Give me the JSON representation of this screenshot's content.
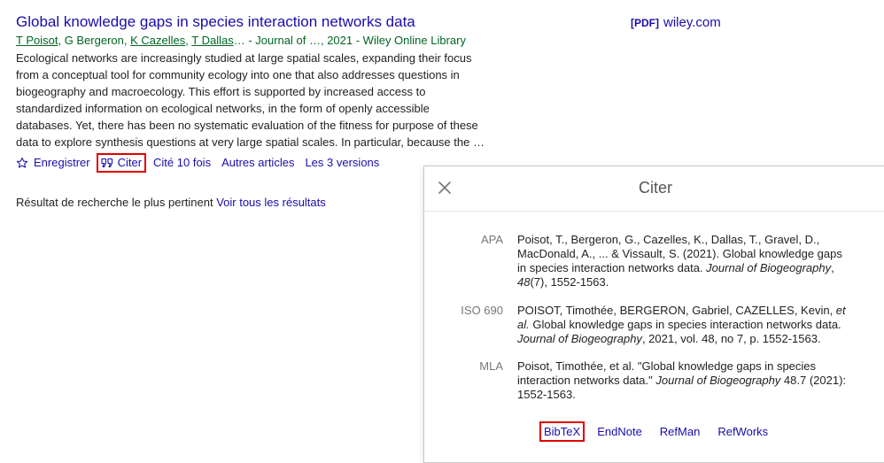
{
  "result": {
    "title": "Global knowledge gaps in species interaction networks data",
    "authors": [
      {
        "name": "T Poisot",
        "linked": true
      },
      {
        "name": "G Bergeron",
        "linked": false
      },
      {
        "name": "K Cazelles",
        "linked": true
      },
      {
        "name": "T Dallas",
        "linked": true
      }
    ],
    "authors_tail": "… - Journal of …, 2021 - Wiley Online Library",
    "snippet": [
      "Ecological networks are increasingly studied at large spatial scales, expanding their focus",
      "from a conceptual tool for community ecology into one that also addresses questions in",
      "biogeography and macroecology. This effort is supported by increased access to",
      "standardized information on ecological networks, in the form of openly accessible",
      "databases. Yet, there has been no systematic evaluation of the fitness for purpose of these",
      "data to explore synthesis questions at very large spatial scales. In particular, because the …"
    ],
    "actions": {
      "save": "Enregistrer",
      "cite": "Citer",
      "cited_by": "Cité 10 fois",
      "related": "Autres articles",
      "versions": "Les 3 versions"
    }
  },
  "pdf_link": {
    "tag": "[PDF]",
    "domain": "wiley.com"
  },
  "relevance": {
    "text": "Résultat de recherche le plus pertinent",
    "see_all": "Voir tous les résultats"
  },
  "dialog": {
    "title": "Citer",
    "citations": [
      {
        "style": "APA",
        "parts": [
          {
            "t": "Poisot, T., Bergeron, G., Cazelles, K., Dallas, T., Gravel, D., MacDonald, A., ... & Vissault, S. (2021). Global knowledge gaps in species interaction networks data. ",
            "i": false
          },
          {
            "t": "Journal of Biogeography",
            "i": true
          },
          {
            "t": ", ",
            "i": false
          },
          {
            "t": "48",
            "i": true
          },
          {
            "t": "(7), 1552-1563.",
            "i": false
          }
        ]
      },
      {
        "style": "ISO 690",
        "parts": [
          {
            "t": "POISOT, Timothée, BERGERON, Gabriel, CAZELLES, Kevin, ",
            "i": false
          },
          {
            "t": "et al.",
            "i": true
          },
          {
            "t": " Global knowledge gaps in species interaction networks data. ",
            "i": false
          },
          {
            "t": "Journal of Biogeography",
            "i": true
          },
          {
            "t": ", 2021, vol. 48, no 7, p. 1552-1563.",
            "i": false
          }
        ]
      },
      {
        "style": "MLA",
        "parts": [
          {
            "t": "Poisot, Timothée, et al. \"Global knowledge gaps in species interaction networks data.\" ",
            "i": false
          },
          {
            "t": "Journal of Biogeography",
            "i": true
          },
          {
            "t": " 48.7 (2021): 1552-1563.",
            "i": false
          }
        ]
      }
    ],
    "exports": [
      "BibTeX",
      "EndNote",
      "RefMan",
      "RefWorks"
    ]
  },
  "colors": {
    "link": "#1a0dab",
    "green": "#006621",
    "highlight": "#e00000"
  }
}
